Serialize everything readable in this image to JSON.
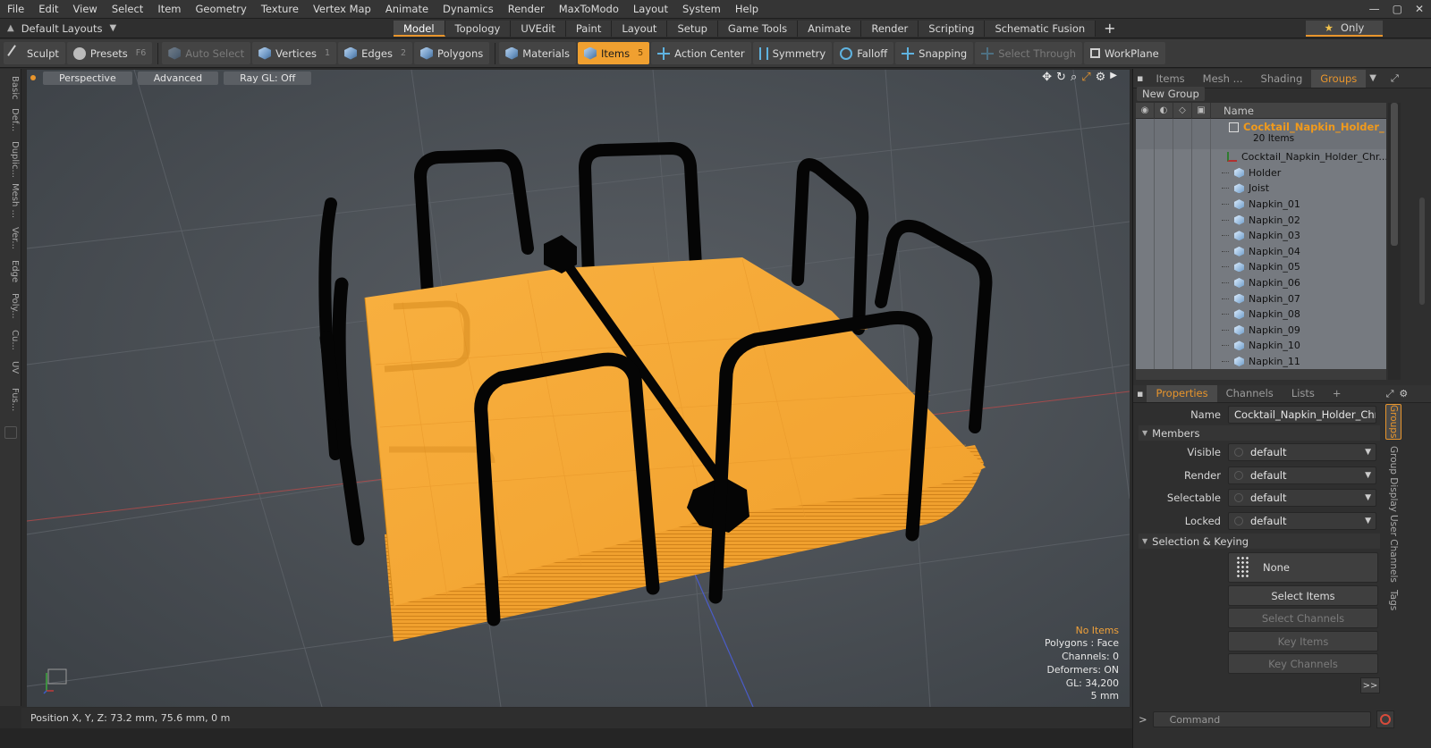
{
  "menu": [
    "File",
    "Edit",
    "View",
    "Select",
    "Item",
    "Geometry",
    "Texture",
    "Vertex Map",
    "Animate",
    "Dynamics",
    "Render",
    "MaxToModo",
    "Layout",
    "System",
    "Help"
  ],
  "window_controls": {
    "minimize": "—",
    "maximize": "▢",
    "close": "✕"
  },
  "layout_selector": {
    "label": "Default Layouts",
    "arrow": "▼"
  },
  "tabs": [
    "Model",
    "Topology",
    "UVEdit",
    "Paint",
    "Layout",
    "Setup",
    "Game Tools",
    "Animate",
    "Render",
    "Scripting",
    "Schematic Fusion"
  ],
  "active_tab": "Model",
  "add_tab": "+",
  "only_button": {
    "star": "★",
    "label": "Only"
  },
  "toolbar": {
    "sculpt": "Sculpt",
    "presets": {
      "label": "Presets",
      "hotkey": "F6"
    },
    "auto_select": "Auto Select",
    "vertices": {
      "label": "Vertices",
      "hotkey": "1"
    },
    "edges": {
      "label": "Edges",
      "hotkey": "2"
    },
    "polygons": "Polygons",
    "materials": "Materials",
    "items": {
      "label": "Items",
      "hotkey": "5"
    },
    "action_center": "Action Center",
    "symmetry": "Symmetry",
    "falloff": "Falloff",
    "snapping": "Snapping",
    "select_through": "Select Through",
    "workplane": "WorkPlane"
  },
  "left_tabs": [
    "Basic",
    "Def...",
    "Duplic...",
    "Mesh ...",
    "Ver...",
    "Edge",
    "Poly...",
    "Cu...",
    "UV",
    "Fus..."
  ],
  "viewport": {
    "perspective": "Perspective",
    "advanced": "Advanced",
    "raygl": "Ray GL: Off",
    "info": {
      "no_items": "No Items",
      "polygons": "Polygons : Face",
      "channels": "Channels: 0",
      "deformers": "Deformers: ON",
      "gl": "GL: 34,200",
      "scale": "5 mm"
    }
  },
  "status": {
    "position": "Position X, Y, Z:   73.2 mm, 75.6 mm, 0 m"
  },
  "right_panel": {
    "tabs": [
      "Items",
      "Mesh ...",
      "Shading",
      "Groups"
    ],
    "active_tab": "Groups",
    "new_group": "New Group",
    "tree_header": "Name",
    "group": {
      "name": "Cocktail_Napkin_Holder_ ...",
      "count": "20 Items"
    },
    "items": [
      {
        "name": "Cocktail_Napkin_Holder_Chr...",
        "icon": "locator-icon"
      },
      {
        "name": "Holder",
        "icon": "mesh-icon"
      },
      {
        "name": "Joist",
        "icon": "mesh-icon"
      },
      {
        "name": "Napkin_01",
        "icon": "mesh-icon"
      },
      {
        "name": "Napkin_02",
        "icon": "mesh-icon"
      },
      {
        "name": "Napkin_03",
        "icon": "mesh-icon"
      },
      {
        "name": "Napkin_04",
        "icon": "mesh-icon"
      },
      {
        "name": "Napkin_05",
        "icon": "mesh-icon"
      },
      {
        "name": "Napkin_06",
        "icon": "mesh-icon"
      },
      {
        "name": "Napkin_07",
        "icon": "mesh-icon"
      },
      {
        "name": "Napkin_08",
        "icon": "mesh-icon"
      },
      {
        "name": "Napkin_09",
        "icon": "mesh-icon"
      },
      {
        "name": "Napkin_10",
        "icon": "mesh-icon"
      },
      {
        "name": "Napkin_11",
        "icon": "mesh-icon"
      }
    ]
  },
  "properties": {
    "tabs": [
      "Properties",
      "Channels",
      "Lists"
    ],
    "active_tab": "Properties",
    "add": "+",
    "name_label": "Name",
    "name_value": "Cocktail_Napkin_Holder_Chrome_",
    "members_section": "Members",
    "visible": {
      "label": "Visible",
      "value": "default"
    },
    "render": {
      "label": "Render",
      "value": "default"
    },
    "selectable": {
      "label": "Selectable",
      "value": "default"
    },
    "locked": {
      "label": "Locked",
      "value": "default"
    },
    "selection_section": "Selection & Keying",
    "none_label": "None",
    "select_items": "Select Items",
    "select_channels": "Select Channels",
    "key_items": "Key Items",
    "key_channels": "Key Channels",
    "expand": ">>",
    "side_tabs": [
      "Groups",
      "Group Display",
      "User Channels",
      "Tags"
    ]
  },
  "command": {
    "placeholder": "Command",
    "prompt": ">"
  },
  "colors": {
    "accent": "#e8952c",
    "napkin": "#f5a733",
    "viewport_bg": "#4a4f55",
    "wire": "#050505"
  }
}
